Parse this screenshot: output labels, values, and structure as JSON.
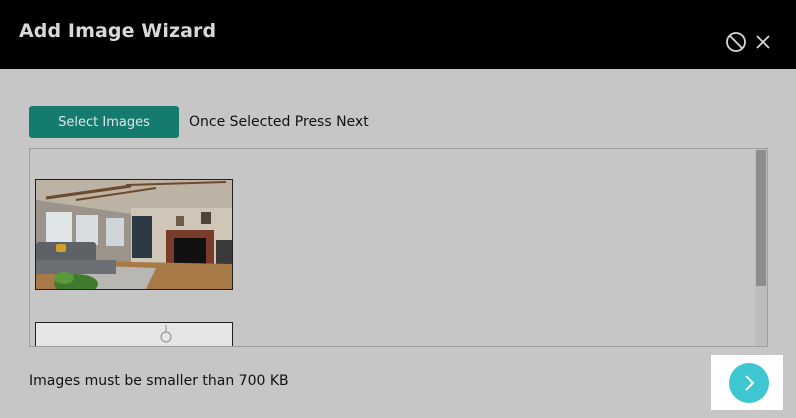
{
  "window": {
    "title": "Add Image Wizard",
    "actions": [
      {
        "icon": "block-icon"
      },
      {
        "icon": "close-icon"
      }
    ]
  },
  "toolbar": {
    "select_label": "Select Images",
    "hint": "Once Selected Press Next"
  },
  "images": [
    {
      "thumbnail": "living-room-photo"
    },
    {
      "thumbnail": "white-room-photo"
    }
  ],
  "footer": {
    "note": "Images must be smaller than 700 KB",
    "next_icon": "chevron-right-icon"
  },
  "colors": {
    "titlebar": "#000000",
    "overlay": "#c6c6c6",
    "accent_button": "#157b6e",
    "next_button": "#3ec6d1"
  }
}
